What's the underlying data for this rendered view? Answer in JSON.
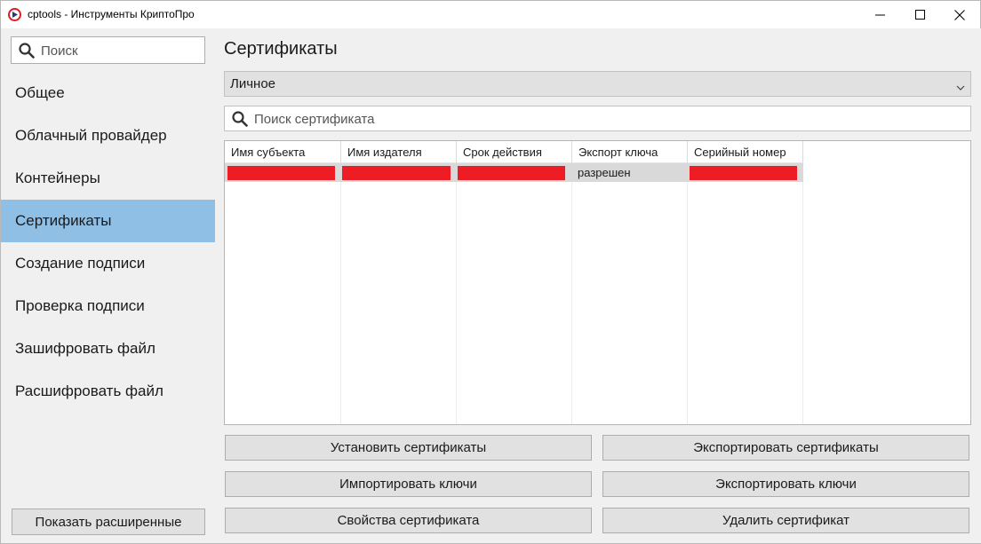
{
  "window": {
    "title": "cptools - Инструменты КриптоПро"
  },
  "sidebar": {
    "search_placeholder": "Поиск",
    "items": [
      {
        "label": "Общее"
      },
      {
        "label": "Облачный провайдер"
      },
      {
        "label": "Контейнеры"
      },
      {
        "label": "Сертификаты",
        "active": true
      },
      {
        "label": "Создание подписи"
      },
      {
        "label": "Проверка подписи"
      },
      {
        "label": "Зашифровать файл"
      },
      {
        "label": "Расшифровать файл"
      }
    ],
    "show_advanced_label": "Показать расширенные",
    "active_color": "#90bfe6"
  },
  "main": {
    "title": "Сертификаты",
    "store_select": {
      "value": "Личное"
    },
    "cert_search_placeholder": "Поиск сертификата",
    "table": {
      "columns": [
        "Имя субъекта",
        "Имя издателя",
        "Срок действия",
        "Экспорт ключа",
        "Серийный номер"
      ],
      "rows": [
        {
          "subject": "",
          "issuer": "",
          "validity": "",
          "key_export": "разрешен",
          "serial": ""
        }
      ],
      "redaction_color": "#ee1c24"
    },
    "buttons": {
      "install_certs": "Установить сертификаты",
      "export_certs": "Экспортировать сертификаты",
      "import_keys": "Импортировать ключи",
      "export_keys": "Экспортировать ключи",
      "cert_properties": "Свойства сертификата",
      "delete_cert": "Удалить сертификат"
    }
  }
}
